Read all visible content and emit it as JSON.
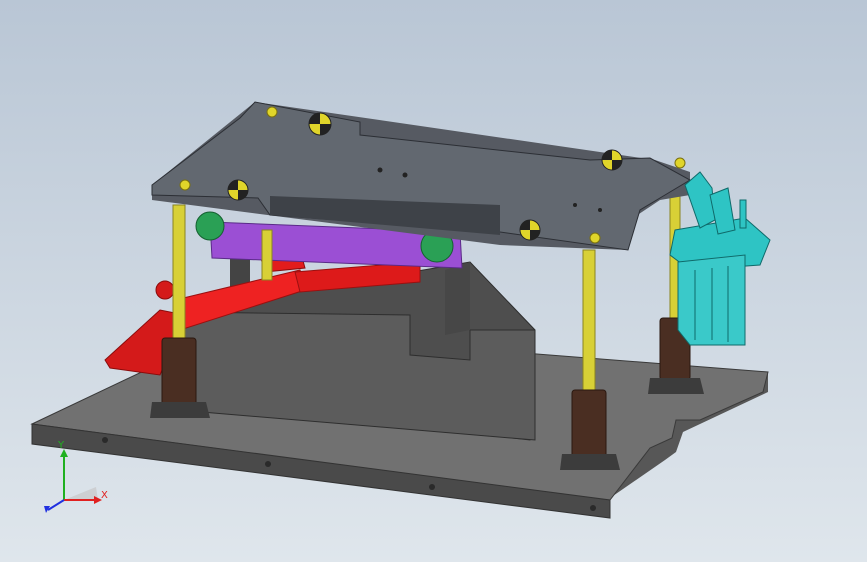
{
  "viewport": {
    "background_top": "#b9c6d5",
    "background_bottom": "#dfe6ec"
  },
  "model": {
    "parts": {
      "base_plate": "#6e6e6e",
      "top_plate": "#626870",
      "fixture_block": "#5a5a5a",
      "guide_pillars": "#d8d036",
      "bushings": "#4a2e22",
      "cylinder": "#ee1e1e",
      "toggle_clamp": "#2ec4c4",
      "carriage": "#9b4fd4",
      "rollers": "#2aa055",
      "bolt_heads": "#e0d52a",
      "fasteners": "#d6cc30"
    }
  },
  "triad": {
    "x_label": "X",
    "y_label": "Y",
    "x_color": "#e02020",
    "y_color": "#20b020",
    "z_color": "#2030e0"
  }
}
